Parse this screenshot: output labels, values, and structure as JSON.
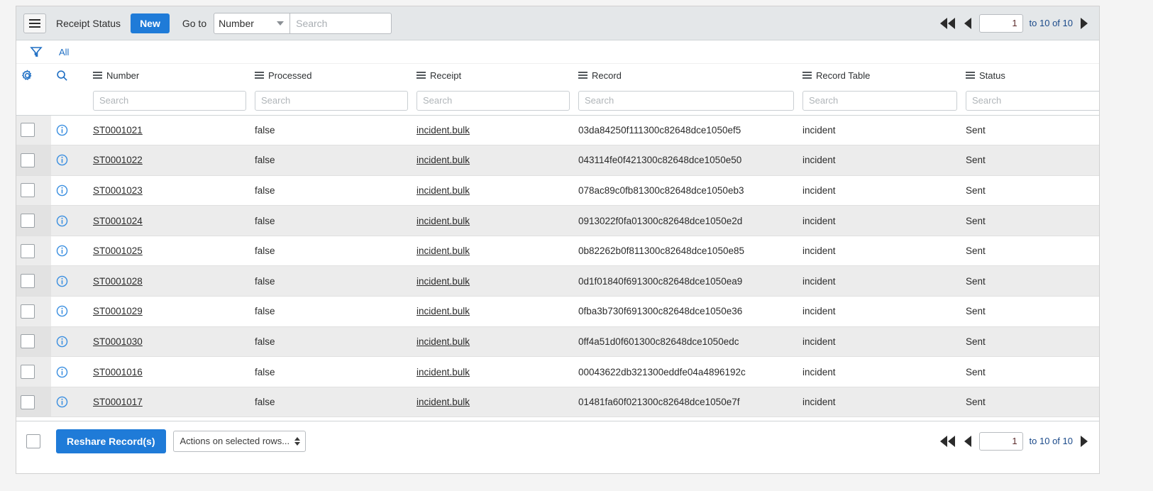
{
  "toolbar": {
    "menu_icon": "hamburger-icon",
    "table_title": "Receipt Status",
    "new_label": "New",
    "goto_label": "Go to",
    "goto_field": "Number",
    "goto_placeholder": "Search"
  },
  "pagination": {
    "page_value": "1",
    "range_text": "to 10 of 10",
    "first_icon": "double-left-arrow-icon",
    "prev_icon": "left-arrow-icon",
    "next_icon": "right-arrow-icon"
  },
  "filterbar": {
    "funnel_icon": "filter-funnel-icon",
    "breadcrumb": "All"
  },
  "columns": [
    {
      "key": "number",
      "label": "Number"
    },
    {
      "key": "processed",
      "label": "Processed"
    },
    {
      "key": "receipt",
      "label": "Receipt"
    },
    {
      "key": "record",
      "label": "Record"
    },
    {
      "key": "record_table",
      "label": "Record Table"
    },
    {
      "key": "status",
      "label": "Status"
    }
  ],
  "column_filter_placeholder": "Search",
  "rows": [
    {
      "number": "ST0001021",
      "processed": "false",
      "receipt": "incident.bulk",
      "record": "03da84250f111300c82648dce1050ef5",
      "record_table": "incident",
      "status": "Sent"
    },
    {
      "number": "ST0001022",
      "processed": "false",
      "receipt": "incident.bulk",
      "record": "043114fe0f421300c82648dce1050e50",
      "record_table": "incident",
      "status": "Sent"
    },
    {
      "number": "ST0001023",
      "processed": "false",
      "receipt": "incident.bulk",
      "record": "078ac89c0fb81300c82648dce1050eb3",
      "record_table": "incident",
      "status": "Sent"
    },
    {
      "number": "ST0001024",
      "processed": "false",
      "receipt": "incident.bulk",
      "record": "0913022f0fa01300c82648dce1050e2d",
      "record_table": "incident",
      "status": "Sent"
    },
    {
      "number": "ST0001025",
      "processed": "false",
      "receipt": "incident.bulk",
      "record": "0b82262b0f811300c82648dce1050e85",
      "record_table": "incident",
      "status": "Sent"
    },
    {
      "number": "ST0001028",
      "processed": "false",
      "receipt": "incident.bulk",
      "record": "0d1f01840f691300c82648dce1050ea9",
      "record_table": "incident",
      "status": "Sent"
    },
    {
      "number": "ST0001029",
      "processed": "false",
      "receipt": "incident.bulk",
      "record": "0fba3b730f691300c82648dce1050e36",
      "record_table": "incident",
      "status": "Sent"
    },
    {
      "number": "ST0001030",
      "processed": "false",
      "receipt": "incident.bulk",
      "record": "0ff4a51d0f601300c82648dce1050edc",
      "record_table": "incident",
      "status": "Sent"
    },
    {
      "number": "ST0001016",
      "processed": "false",
      "receipt": "incident.bulk",
      "record": "00043622db321300eddfe04a4896192c",
      "record_table": "incident",
      "status": "Sent"
    },
    {
      "number": "ST0001017",
      "processed": "false",
      "receipt": "incident.bulk",
      "record": "01481fa60f021300c82648dce1050e7f",
      "record_table": "incident",
      "status": "Sent"
    }
  ],
  "footer": {
    "reshare_label": "Reshare Record(s)",
    "actions_label": "Actions on selected rows...",
    "page_value": "1",
    "range_text": "to 10 of 10"
  },
  "colors": {
    "accent_blue": "#1f7bd8",
    "link_blue": "#1f6fc4",
    "toolbar_bg": "#e4e7e9",
    "row_alt": "#ececec"
  }
}
